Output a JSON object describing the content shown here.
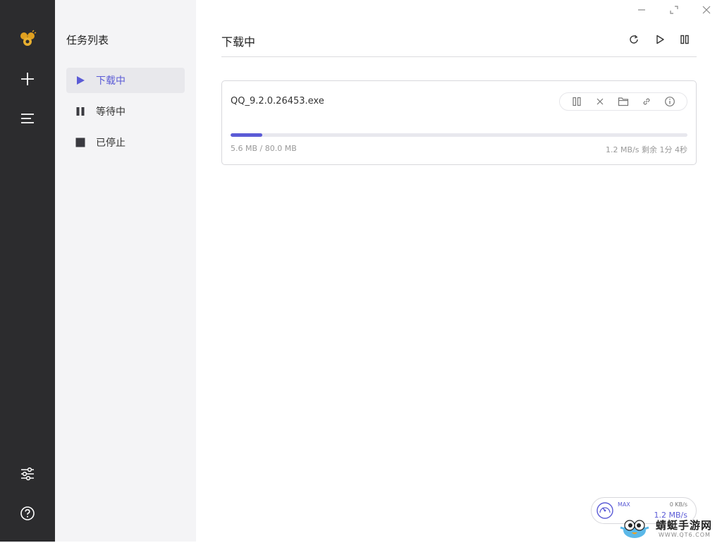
{
  "sidebar": {
    "title": "任务列表",
    "items": [
      {
        "label": "下载中",
        "icon": "play-icon",
        "active": true
      },
      {
        "label": "等待中",
        "icon": "pause-icon",
        "active": false
      },
      {
        "label": "已停止",
        "icon": "stop-icon",
        "active": false
      }
    ]
  },
  "rail": {
    "icons": [
      "app-logo-icon",
      "plus-icon",
      "menu-icon",
      "preferences-icon",
      "help-icon"
    ]
  },
  "main": {
    "title": "下载中",
    "header_icons": [
      "refresh-icon",
      "resume-all-icon",
      "pause-all-icon"
    ]
  },
  "task": {
    "name": "QQ_9.2.0.26453.exe",
    "size": "5.6 MB / 80.0 MB",
    "speed": "1.2 MB/s 剩余 1分 4秒",
    "progress": 0.07,
    "action_icons": [
      "pause-icon",
      "delete-icon",
      "folder-icon",
      "link-icon",
      "info-icon"
    ]
  },
  "speedometer": {
    "max_label": "MAX",
    "upload": "0 KB/s",
    "download": "1.2 MB/s"
  },
  "watermark": {
    "text": "蜻蜓手游网",
    "url": "WWW.QT6.COM"
  },
  "colors": {
    "accent": "#5b5bd6",
    "rail_bg": "#2c2c2e",
    "sidebar_bg": "#f4f4f6"
  }
}
